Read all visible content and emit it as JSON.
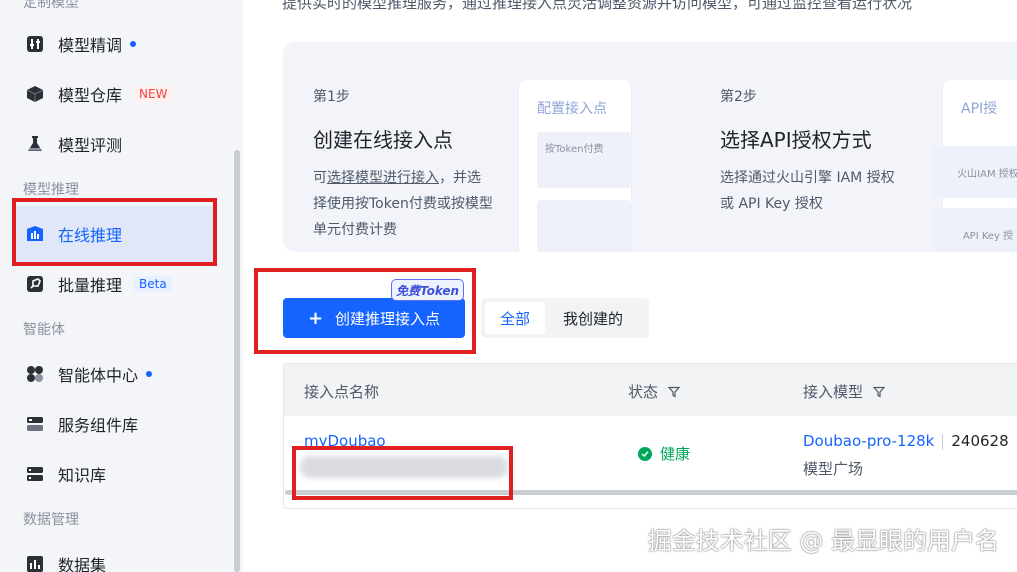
{
  "sidebar": {
    "top_cut_label": "定制模型",
    "items": [
      {
        "label": "模型精调",
        "badge_dot": true
      },
      {
        "label": "模型仓库",
        "tag": "NEW"
      },
      {
        "label": "模型评测"
      },
      {
        "label": "在线推理",
        "active": true
      },
      {
        "label": "批量推理",
        "tag": "Beta"
      },
      {
        "label": "智能体中心",
        "badge_dot": true
      },
      {
        "label": "服务组件库"
      },
      {
        "label": "知识库"
      },
      {
        "label": "数据集"
      }
    ],
    "sections": [
      "模型推理",
      "智能体",
      "数据管理"
    ]
  },
  "main": {
    "intro": "提供实时的模型推理服务，通过推理接入点灵活调整资源并访问模型，可通过监控查看运行状况",
    "steps": [
      {
        "num": "第1步",
        "title": "创建在线接入点",
        "desc_prefix": "可",
        "desc_link": "选择模型进行接入",
        "desc_rest1": "，并选",
        "desc_line2": "择使用按Token付费或按模型",
        "desc_line3": "单元付费计费",
        "mock_title": "配置接入点",
        "mock_chip": "按Token付费"
      },
      {
        "num": "第2步",
        "title": "选择API授权方式",
        "desc_line1": "选择通过火山引擎 IAM 授权",
        "desc_line2": "或 API Key 授权",
        "mock_title": "API授",
        "mock_chip1": "火山IAM 授权",
        "mock_chip2": "API Key 授"
      }
    ],
    "create_button": "创建推理接入点",
    "free_tag": "免费Token",
    "segment": {
      "all": "全部",
      "mine": "我创建的"
    },
    "table": {
      "headers": {
        "name": "接入点名称",
        "status": "状态",
        "model": "接入模型"
      },
      "rows": [
        {
          "name": "myDoubao",
          "status": "健康",
          "model": "Doubao-pro-128k",
          "version": "240628",
          "source": "模型广场"
        }
      ]
    }
  },
  "watermark": "掘金技术社区 @ 最显眼的用户名",
  "colors": {
    "accent": "#1664ff",
    "highlight": "#e02020",
    "healthy": "#00a75b"
  }
}
